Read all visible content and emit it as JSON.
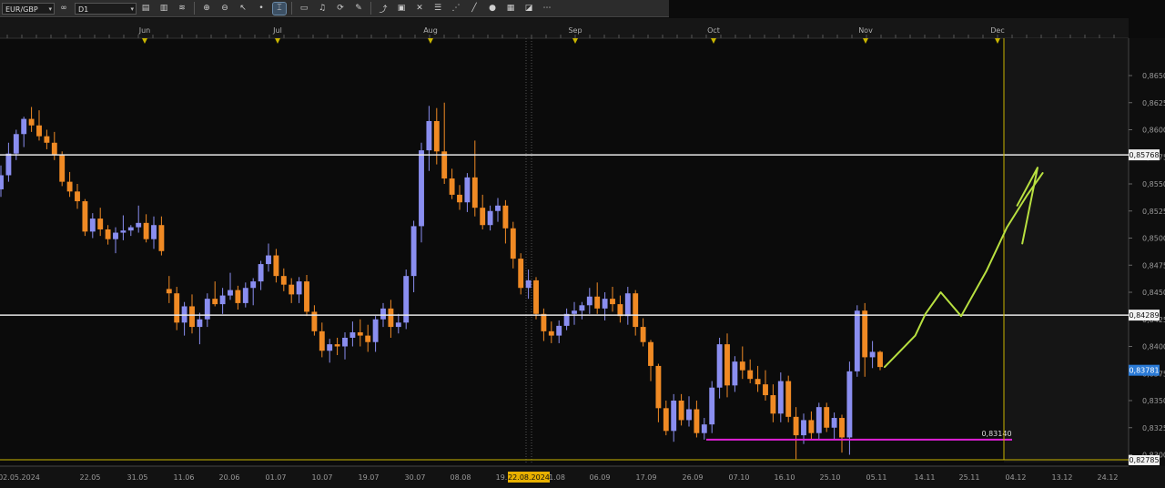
{
  "toolbar": {
    "symbol": "EUR/GBP",
    "timeframe": "D1",
    "tools": [
      {
        "name": "chart-type-icon",
        "glyph": "▤"
      },
      {
        "name": "volume-icon",
        "glyph": "▥"
      },
      {
        "name": "indicator-icon",
        "glyph": "≋"
      },
      {
        "name": "zoom-in-icon",
        "glyph": "⊕"
      },
      {
        "name": "zoom-out-icon",
        "glyph": "⊖"
      },
      {
        "name": "cursor-icon",
        "glyph": "↖"
      },
      {
        "name": "dot-icon",
        "glyph": "•"
      },
      {
        "name": "crosshair-icon",
        "glyph": "⌶"
      },
      {
        "name": "note-icon",
        "glyph": "▭"
      },
      {
        "name": "bell-icon",
        "glyph": "♫"
      },
      {
        "name": "refresh-icon",
        "glyph": "⟳"
      },
      {
        "name": "pencil-icon",
        "glyph": "✎"
      },
      {
        "name": "trend-icon",
        "glyph": "⤴"
      },
      {
        "name": "window-icon",
        "glyph": "▣"
      },
      {
        "name": "cross-icon",
        "glyph": "✕"
      },
      {
        "name": "lines-icon",
        "glyph": "☰"
      },
      {
        "name": "fib-icon",
        "glyph": "⋰"
      },
      {
        "name": "ruler-icon",
        "glyph": "╱"
      },
      {
        "name": "circle-icon",
        "glyph": "●"
      },
      {
        "name": "grid-icon",
        "glyph": "▦"
      },
      {
        "name": "eraser-icon",
        "glyph": "◪"
      },
      {
        "name": "settings-icon",
        "glyph": "⋯"
      }
    ]
  },
  "colors": {
    "bull": "#8a8ef0",
    "bear": "#f08a24",
    "support": "#e020d8",
    "forecast": "#b8e040",
    "level": "#e6e6e6",
    "marker": "#c8b400"
  },
  "axis": {
    "price_ticks": [
      "0,8650",
      "0,8625",
      "0,8600",
      "0,8575",
      "0,8550",
      "0,8525",
      "0,8500",
      "0,8475",
      "0,8450",
      "0,8425",
      "0,8400",
      "0,8375",
      "0,8350",
      "0,8325",
      "0,8300"
    ],
    "month_labels": [
      "Jun",
      "Jul",
      "Aug",
      "Sep",
      "Oct",
      "Nov",
      "Dec"
    ],
    "date_labels": [
      "02.05.2024",
      "22.05",
      "31.05",
      "11.06",
      "20.06",
      "01.07",
      "10.07",
      "19.07",
      "30.07",
      "08.08",
      "19.",
      "22.08.2024",
      "1.08",
      "06.09",
      "17.09",
      "26.09",
      "07.10",
      "16.10",
      "25.10",
      "05.11",
      "14.11",
      "25.11",
      "04.12",
      "13.12",
      "24.12"
    ]
  },
  "levels": {
    "upper": "0,85768",
    "lower": "0,84289",
    "current": "0,83781",
    "bottom": "0,82785",
    "support": "0,83140"
  },
  "chart_data": {
    "type": "candlestick",
    "symbol": "EUR/GBP",
    "timeframe": "D1",
    "ylim": [
      0.8278,
      0.8662
    ],
    "candles": [
      [
        0.8545,
        0.8567,
        0.8538,
        0.8558
      ],
      [
        0.8558,
        0.8588,
        0.8552,
        0.8578
      ],
      [
        0.8578,
        0.86,
        0.8572,
        0.8596
      ],
      [
        0.8596,
        0.8612,
        0.8584,
        0.861
      ],
      [
        0.861,
        0.8621,
        0.8598,
        0.8604
      ],
      [
        0.8604,
        0.8618,
        0.859,
        0.8594
      ],
      [
        0.8594,
        0.86,
        0.8582,
        0.8588
      ],
      [
        0.8588,
        0.8598,
        0.8572,
        0.8577
      ],
      [
        0.8577,
        0.858,
        0.8548,
        0.8552
      ],
      [
        0.8552,
        0.8561,
        0.8538,
        0.8543
      ],
      [
        0.8543,
        0.855,
        0.8527,
        0.8534
      ],
      [
        0.8534,
        0.8536,
        0.8502,
        0.8506
      ],
      [
        0.8506,
        0.8523,
        0.85,
        0.8518
      ],
      [
        0.8518,
        0.8528,
        0.8502,
        0.8508
      ],
      [
        0.8508,
        0.8512,
        0.8494,
        0.8499
      ],
      [
        0.8499,
        0.851,
        0.8486,
        0.8505
      ],
      [
        0.8505,
        0.8521,
        0.8498,
        0.8507
      ],
      [
        0.8507,
        0.8512,
        0.8502,
        0.851
      ],
      [
        0.851,
        0.853,
        0.8505,
        0.8514
      ],
      [
        0.8514,
        0.8522,
        0.8496,
        0.8499
      ],
      [
        0.8499,
        0.852,
        0.849,
        0.8512
      ],
      [
        0.8512,
        0.852,
        0.8484,
        0.8488
      ],
      [
        0.8453,
        0.8465,
        0.844,
        0.8449
      ],
      [
        0.8449,
        0.8455,
        0.8415,
        0.8422
      ],
      [
        0.8422,
        0.8441,
        0.841,
        0.8437
      ],
      [
        0.8437,
        0.8448,
        0.8412,
        0.8418
      ],
      [
        0.8418,
        0.8431,
        0.8402,
        0.8425
      ],
      [
        0.8425,
        0.8449,
        0.8418,
        0.8444
      ],
      [
        0.8444,
        0.846,
        0.8437,
        0.8439
      ],
      [
        0.8439,
        0.8454,
        0.843,
        0.8447
      ],
      [
        0.8447,
        0.8468,
        0.8443,
        0.8452
      ],
      [
        0.8452,
        0.8456,
        0.8434,
        0.844
      ],
      [
        0.844,
        0.8459,
        0.8436,
        0.8454
      ],
      [
        0.8454,
        0.8463,
        0.8438,
        0.846
      ],
      [
        0.846,
        0.8479,
        0.8452,
        0.8476
      ],
      [
        0.8476,
        0.8495,
        0.8469,
        0.8484
      ],
      [
        0.8484,
        0.849,
        0.8459,
        0.8465
      ],
      [
        0.8465,
        0.8472,
        0.8451,
        0.8457
      ],
      [
        0.8457,
        0.8463,
        0.844,
        0.8448
      ],
      [
        0.8448,
        0.8464,
        0.844,
        0.846
      ],
      [
        0.846,
        0.8466,
        0.8428,
        0.8432
      ],
      [
        0.8432,
        0.8438,
        0.841,
        0.8414
      ],
      [
        0.8414,
        0.8422,
        0.839,
        0.8396
      ],
      [
        0.8396,
        0.8407,
        0.8385,
        0.8402
      ],
      [
        0.8402,
        0.8408,
        0.8392,
        0.84
      ],
      [
        0.84,
        0.8413,
        0.8388,
        0.8408
      ],
      [
        0.8408,
        0.8423,
        0.84,
        0.8413
      ],
      [
        0.8413,
        0.8425,
        0.84,
        0.841
      ],
      [
        0.841,
        0.842,
        0.8395,
        0.8404
      ],
      [
        0.8404,
        0.8428,
        0.8395,
        0.8425
      ],
      [
        0.8425,
        0.844,
        0.8418,
        0.8435
      ],
      [
        0.8435,
        0.8443,
        0.8408,
        0.8418
      ],
      [
        0.8418,
        0.843,
        0.8412,
        0.8422
      ],
      [
        0.8422,
        0.8471,
        0.8416,
        0.8465
      ],
      [
        0.8465,
        0.8516,
        0.845,
        0.8511
      ],
      [
        0.8511,
        0.8588,
        0.8496,
        0.8581
      ],
      [
        0.8581,
        0.8622,
        0.8562,
        0.8608
      ],
      [
        0.8608,
        0.862,
        0.8568,
        0.858
      ],
      [
        0.858,
        0.8625,
        0.855,
        0.8555
      ],
      [
        0.8555,
        0.8564,
        0.8536,
        0.854
      ],
      [
        0.854,
        0.8549,
        0.8526,
        0.8533
      ],
      [
        0.8533,
        0.856,
        0.8524,
        0.8556
      ],
      [
        0.8556,
        0.859,
        0.852,
        0.8528
      ],
      [
        0.8528,
        0.854,
        0.8508,
        0.8512
      ],
      [
        0.8512,
        0.853,
        0.8507,
        0.8525
      ],
      [
        0.8525,
        0.8537,
        0.8515,
        0.853
      ],
      [
        0.853,
        0.8535,
        0.8495,
        0.8509
      ],
      [
        0.8509,
        0.8515,
        0.8472,
        0.8481
      ],
      [
        0.8481,
        0.8486,
        0.8448,
        0.8454
      ],
      [
        0.8454,
        0.8471,
        0.8444,
        0.8461
      ],
      [
        0.8461,
        0.8464,
        0.8425,
        0.843
      ],
      [
        0.843,
        0.8435,
        0.8405,
        0.8414
      ],
      [
        0.8414,
        0.8423,
        0.8403,
        0.841
      ],
      [
        0.841,
        0.8424,
        0.8403,
        0.8419
      ],
      [
        0.8419,
        0.8435,
        0.8415,
        0.843
      ],
      [
        0.843,
        0.8441,
        0.842,
        0.8433
      ],
      [
        0.8433,
        0.8441,
        0.8425,
        0.8438
      ],
      [
        0.8438,
        0.8454,
        0.843,
        0.8446
      ],
      [
        0.8446,
        0.8459,
        0.843,
        0.8435
      ],
      [
        0.8435,
        0.845,
        0.8424,
        0.8444
      ],
      [
        0.8444,
        0.8455,
        0.8432,
        0.8439
      ],
      [
        0.8439,
        0.8447,
        0.8422,
        0.8428
      ],
      [
        0.8428,
        0.8455,
        0.842,
        0.8449
      ],
      [
        0.8449,
        0.8452,
        0.841,
        0.8418
      ],
      [
        0.8418,
        0.8426,
        0.84,
        0.8404
      ],
      [
        0.8404,
        0.8406,
        0.8368,
        0.8382
      ],
      [
        0.8382,
        0.8384,
        0.833,
        0.8343
      ],
      [
        0.8343,
        0.835,
        0.8318,
        0.8322
      ],
      [
        0.8322,
        0.8356,
        0.8312,
        0.835
      ],
      [
        0.835,
        0.8356,
        0.8327,
        0.8332
      ],
      [
        0.8332,
        0.8354,
        0.8326,
        0.8342
      ],
      [
        0.8342,
        0.835,
        0.8316,
        0.832
      ],
      [
        0.832,
        0.8334,
        0.8314,
        0.8328
      ],
      [
        0.8328,
        0.8368,
        0.832,
        0.8362
      ],
      [
        0.8362,
        0.8408,
        0.8352,
        0.8402
      ],
      [
        0.8402,
        0.8412,
        0.8353,
        0.8364
      ],
      [
        0.8364,
        0.8391,
        0.8358,
        0.8386
      ],
      [
        0.8386,
        0.84,
        0.837,
        0.8378
      ],
      [
        0.8378,
        0.8388,
        0.8366,
        0.837
      ],
      [
        0.837,
        0.8382,
        0.8358,
        0.8365
      ],
      [
        0.8365,
        0.8378,
        0.835,
        0.8355
      ],
      [
        0.8355,
        0.8365,
        0.833,
        0.8338
      ],
      [
        0.8338,
        0.8376,
        0.833,
        0.8368
      ],
      [
        0.8368,
        0.8373,
        0.833,
        0.8335
      ],
      [
        0.8335,
        0.8344,
        0.8296,
        0.8318
      ],
      [
        0.8318,
        0.8338,
        0.831,
        0.8332
      ],
      [
        0.8332,
        0.834,
        0.8314,
        0.832
      ],
      [
        0.832,
        0.8348,
        0.8314,
        0.8344
      ],
      [
        0.8344,
        0.8348,
        0.8321,
        0.8325
      ],
      [
        0.8325,
        0.8339,
        0.8314,
        0.8334
      ],
      [
        0.8334,
        0.8337,
        0.8302,
        0.8316
      ],
      [
        0.8316,
        0.8386,
        0.83,
        0.8377
      ],
      [
        0.8377,
        0.8438,
        0.8372,
        0.8433
      ],
      [
        0.8433,
        0.844,
        0.8372,
        0.839
      ],
      [
        0.839,
        0.8405,
        0.838,
        0.8395
      ],
      [
        0.8395,
        0.8396,
        0.8378,
        0.8381
      ]
    ],
    "horizontal_lines": [
      0.85768,
      0.84289
    ],
    "support_line": 0.8314,
    "forecast_path": [
      [
        0,
        0.8381
      ],
      [
        6,
        0.841
      ],
      [
        8,
        0.843
      ],
      [
        11,
        0.845
      ],
      [
        15,
        0.8428
      ],
      [
        20,
        0.847
      ],
      [
        24,
        0.851
      ],
      [
        28,
        0.854
      ],
      [
        31,
        0.856
      ]
    ],
    "forecast_arrow": [
      [
        26,
        0.853
      ],
      [
        30,
        0.8565
      ],
      [
        27,
        0.8495
      ]
    ],
    "month_markers": [
      "Jun",
      "Jul",
      "Aug",
      "Sep",
      "Oct",
      "Nov",
      "Dec"
    ]
  }
}
